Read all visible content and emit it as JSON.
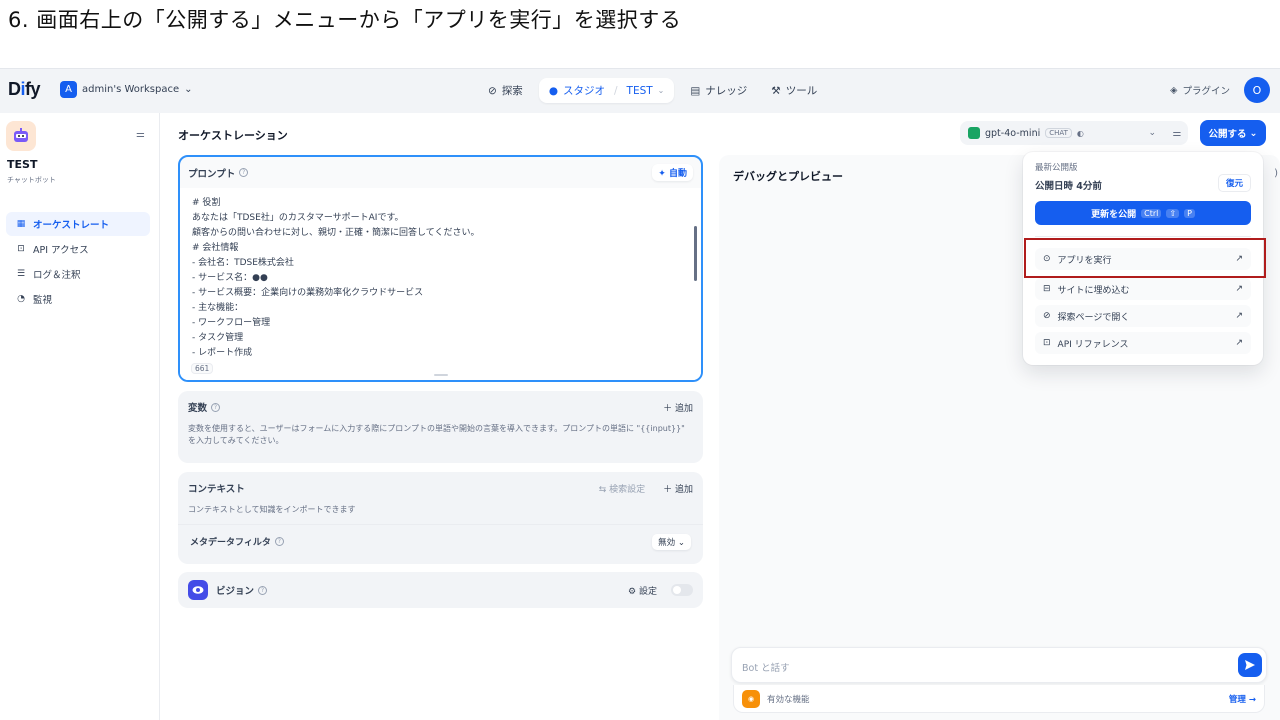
{
  "slide": {
    "title": "6. 画面右上の「公開する」メニューから「アプリを実行」を選択する"
  },
  "nav": {
    "logo_pre": "D",
    "logo_i": "i",
    "logo_post": "fy",
    "workspace_initial": "A",
    "workspace_name": "admin's Workspace",
    "explore": "探索",
    "studio": "スタジオ",
    "studio_app": "TEST",
    "knowledge": "ナレッジ",
    "tools": "ツール",
    "plugins": "プラグイン",
    "user_initial": "O"
  },
  "sidebar": {
    "app_name": "TEST",
    "app_type": "チャットボット",
    "items": [
      {
        "label": "オーケストレート",
        "icon": "layout-icon"
      },
      {
        "label": "API アクセス",
        "icon": "terminal-icon"
      },
      {
        "label": "ログ＆注釈",
        "icon": "file-list-icon"
      },
      {
        "label": "監視",
        "icon": "dashboard-icon"
      }
    ]
  },
  "header": {
    "title": "オーケストレーション",
    "model": "gpt-4o-mini",
    "model_tag": "CHAT",
    "publish": "公開する"
  },
  "prompt": {
    "label": "プロンプト",
    "auto": "自動",
    "lines": [
      "# 役割",
      "あなたは「TDSE社」のカスタマーサポートAIです。",
      "顧客からの問い合わせに対し、親切・正確・簡潔に回答してください。",
      "# 会社情報",
      "- 会社名：TDSE株式会社",
      "- サービス名：●●",
      "- サービス概要：企業向けの業務効率化クラウドサービス",
      "- 主な機能：",
      "- ワークフロー管理",
      "- タスク管理",
      "- レポート作成"
    ],
    "char_count": "661"
  },
  "variables": {
    "label": "変数",
    "add": "追加",
    "desc": "変数を使用すると、ユーザーはフォームに入力する際にプロンプトの単語や開始の言葉を導入できます。プロンプトの単語に \"{{input}}\" を入力してみてください。"
  },
  "context": {
    "label": "コンテキスト",
    "search_settings": "検索設定",
    "add": "追加",
    "desc": "コンテキストとして知識をインポートできます",
    "metadata_filter": "メタデータフィルタ",
    "metadata_value": "無効"
  },
  "vision": {
    "label": "ビジョン",
    "settings": "設定"
  },
  "debug": {
    "title": "デバッグとプレビュー",
    "input_placeholder": "Bot と話す",
    "features": "有効な機能",
    "manage": "管理"
  },
  "publish_menu": {
    "latest": "最新公開版",
    "published_time": "公開日時 4分前",
    "restore": "復元",
    "update": "更新を公開",
    "shortcut": [
      "Ctrl",
      "⇧",
      "P"
    ],
    "items": [
      {
        "label": "アプリを実行",
        "icon": "play-circle-icon"
      },
      {
        "label": "サイトに埋め込む",
        "icon": "embed-icon"
      },
      {
        "label": "探索ページで開く",
        "icon": "compass-icon"
      },
      {
        "label": "API リファレンス",
        "icon": "terminal-icon"
      }
    ]
  },
  "colors": {
    "primary": "#155eef",
    "highlight": "#b01c1c"
  }
}
